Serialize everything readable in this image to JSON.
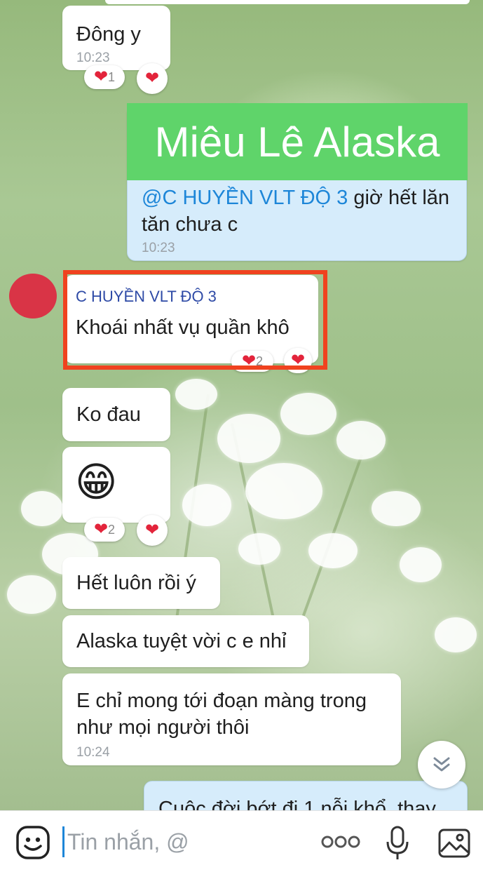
{
  "overlay": {
    "title": "Miêu Lê Alaska"
  },
  "messages": {
    "m1": {
      "text": "Đông y",
      "time": "10:23",
      "reaction_count": "1"
    },
    "m2": {
      "mention": "@C HUYỀN VLT ĐỘ 3",
      "text_line1": " giờ hết lăn",
      "text_line2": "tăn chưa c",
      "time": "10:23"
    },
    "m3": {
      "sender": "C HUYỀN VLT ĐỘ 3",
      "text": "Khoái nhất vụ quần khô",
      "reaction_count": "2"
    },
    "m4": {
      "text": "Ko đau"
    },
    "m5": {
      "emoji": "😁",
      "reaction_count": "2"
    },
    "m6": {
      "text": "Hết luôn rồi ý"
    },
    "m7": {
      "text": "Alaska tuyệt vời c e nhỉ"
    },
    "m8": {
      "text_line1": "E chỉ mong tới đoạn màng trong",
      "text_line2": "như mọi người thôi",
      "time": "10:24"
    },
    "m9": {
      "text": "Cuộc đời bớt đi 1 nỗi khổ, thay"
    }
  },
  "composer": {
    "placeholder": "Tin nhắn, @",
    "icons": [
      "sticker-icon",
      "more-options-icon",
      "microphone-icon",
      "image-icon"
    ]
  },
  "colors": {
    "reaction_heart": "#e3243b",
    "highlight_border": "#f0421f",
    "mention": "#1d86d8",
    "overlay_banner": "#5fd46a",
    "my_bubble": "#d6ecfb"
  }
}
